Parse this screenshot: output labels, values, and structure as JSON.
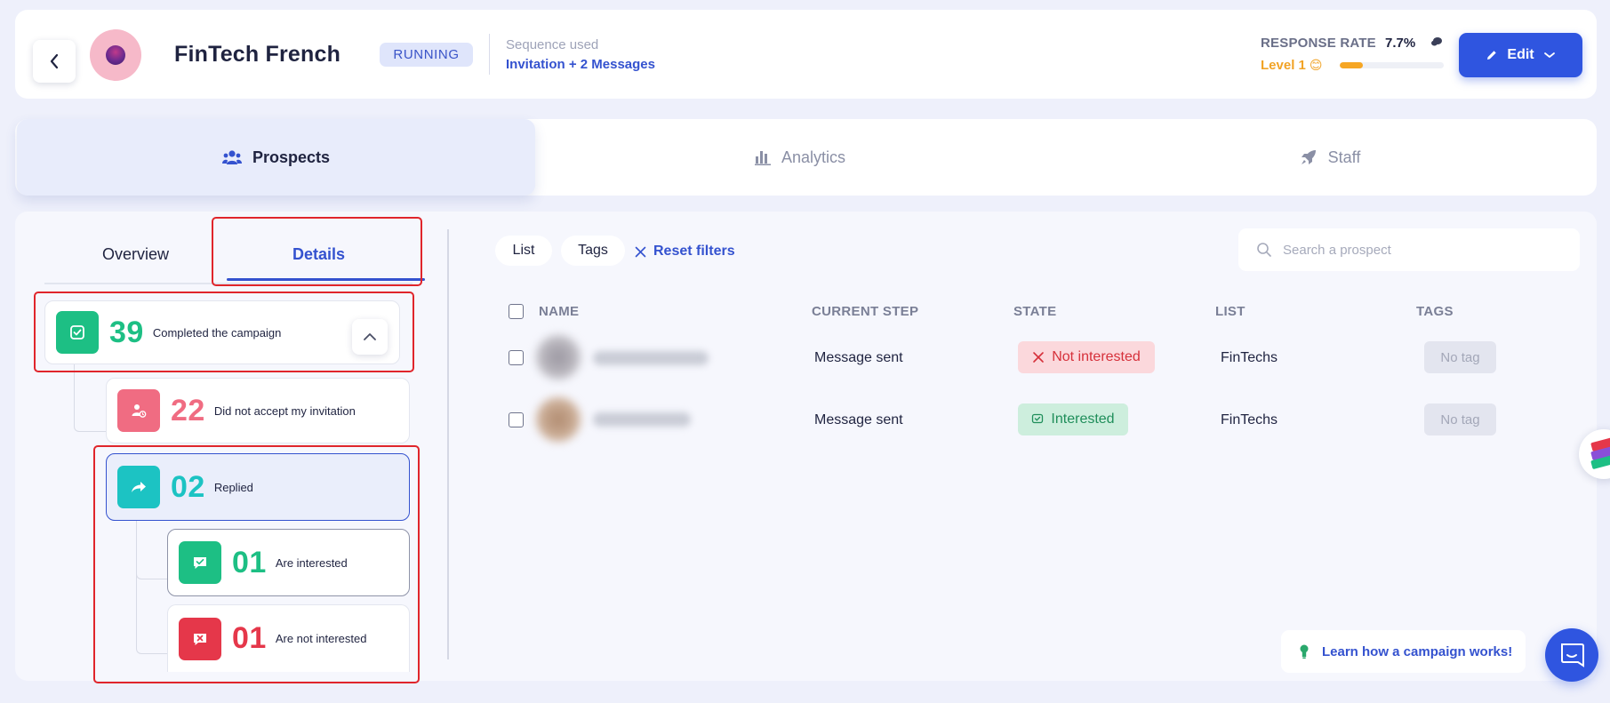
{
  "header": {
    "back_label": "Back",
    "campaign_name": "FinTech French",
    "status": "RUNNING",
    "sequence_label": "Sequence used",
    "sequence_value": "Invitation + 2 Messages",
    "response_rate_label": "RESPONSE RATE",
    "response_rate_value": "7.7%",
    "level_label": "Level 1",
    "level_emoji": "😊",
    "level_progress_fraction": 0.22,
    "edit_label": "Edit"
  },
  "tabs": [
    {
      "label": "Prospects",
      "icon": "users-icon",
      "active": true
    },
    {
      "label": "Analytics",
      "icon": "bar-chart-icon",
      "active": false
    },
    {
      "label": "Staff",
      "icon": "rocket-icon",
      "active": false
    }
  ],
  "left_panel": {
    "subtabs": {
      "overview": "Overview",
      "details": "Details",
      "active": "details"
    },
    "completed": {
      "count": "39",
      "label": "Completed the campaign",
      "color": "#1dbf84"
    },
    "not_accepted": {
      "count": "22",
      "label": "Did not accept my invitation",
      "color": "#f06c82"
    },
    "replied": {
      "count": "02",
      "label": "Replied",
      "color": "#1cc3c3"
    },
    "interested": {
      "count": "01",
      "label": "Are interested",
      "color": "#1dbf84"
    },
    "not_interested": {
      "count": "01",
      "label": "Are not interested",
      "color": "#e5374a"
    }
  },
  "filters": {
    "list_label": "List",
    "tags_label": "Tags",
    "reset_label": "Reset filters",
    "search_placeholder": "Search a prospect"
  },
  "table": {
    "columns": [
      "NAME",
      "CURRENT STEP",
      "STATE",
      "LIST",
      "TAGS"
    ],
    "rows": [
      {
        "current_step": "Message sent",
        "state": "Not interested",
        "list": "FinTechs",
        "tags": "No tag"
      },
      {
        "current_step": "Message sent",
        "state": "Interested",
        "list": "FinTechs",
        "tags": "No tag"
      }
    ]
  },
  "footer": {
    "learn_label": "Learn how a campaign works!"
  },
  "colors": {
    "accent": "#2f55e0",
    "link": "#3452cf",
    "annotation_red": "#e0252b"
  }
}
